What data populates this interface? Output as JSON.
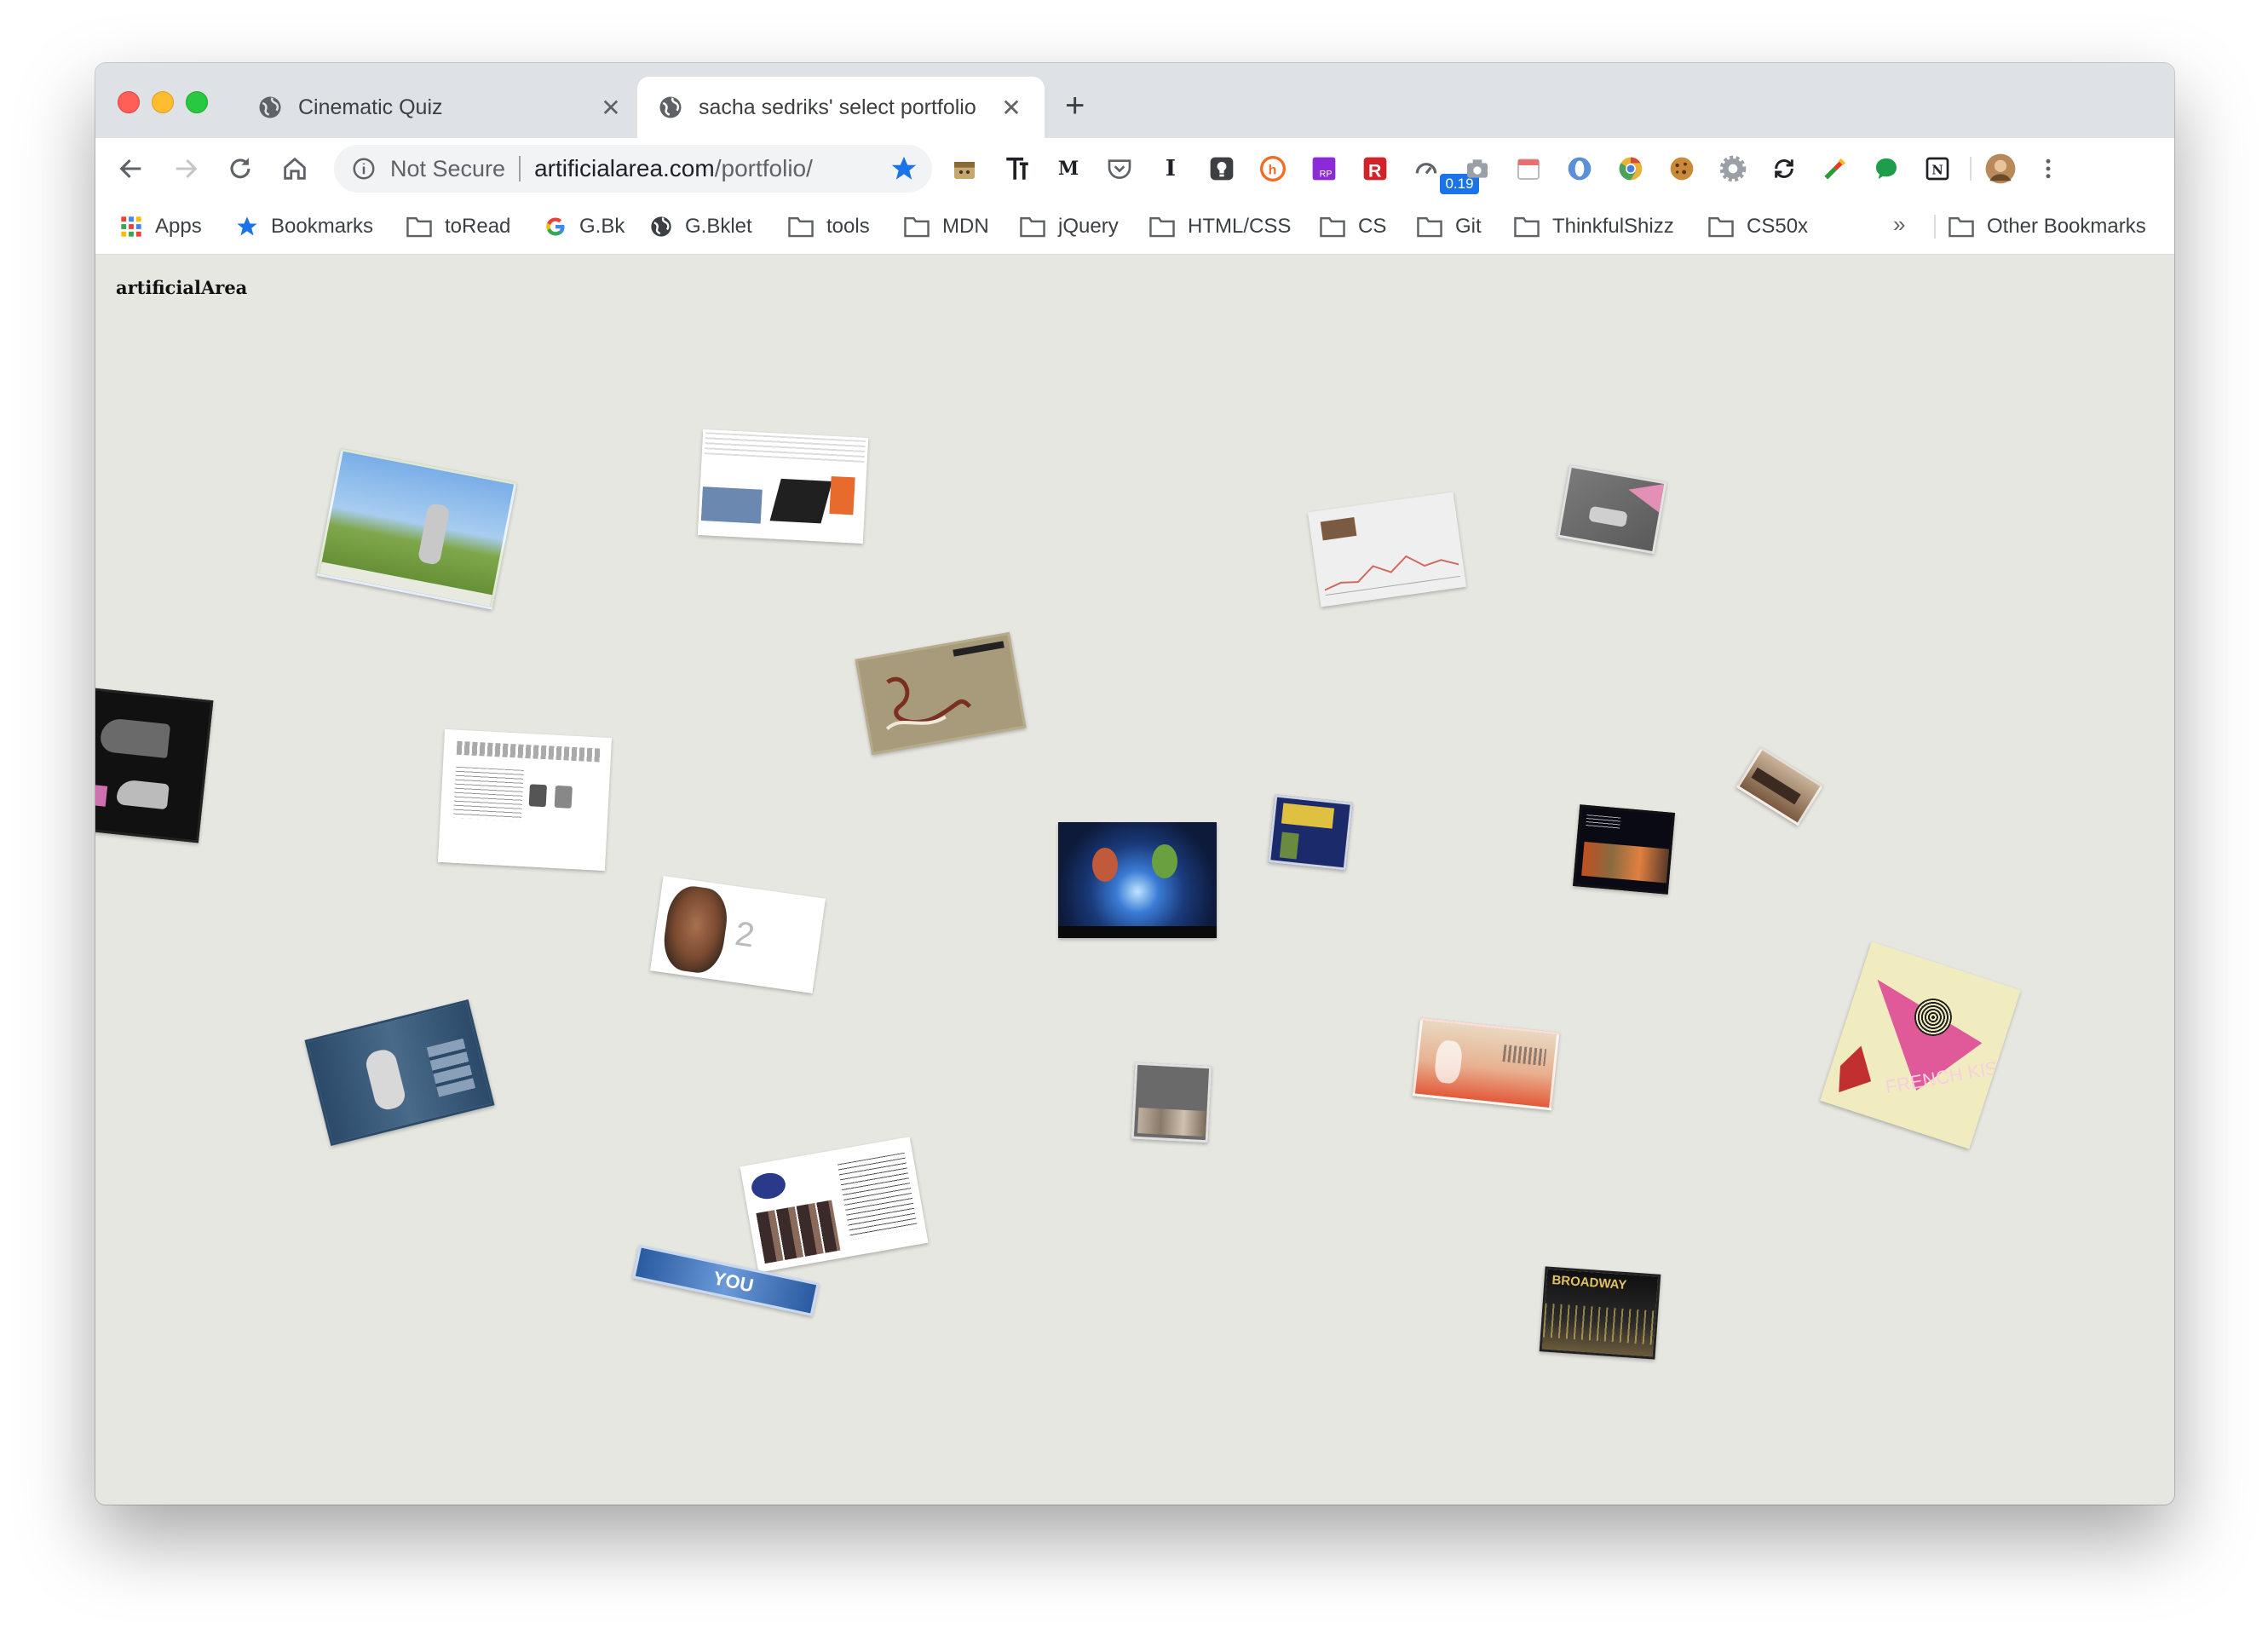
{
  "tabs": [
    {
      "title": "Cinematic Quiz",
      "close": "✕"
    },
    {
      "title": "sacha sedriks' select portfolio",
      "close": "✕"
    }
  ],
  "new_tab": "+",
  "omnibox": {
    "security": "Not Secure",
    "host": "artificialarea.com",
    "path": "/portfolio/"
  },
  "extension_badge": "0.19",
  "bookmarks": [
    {
      "label": "Apps",
      "icon": "apps-grid-icon"
    },
    {
      "label": "Bookmarks",
      "icon": "star-icon"
    },
    {
      "label": "toRead",
      "icon": "folder-icon"
    },
    {
      "label": "G.Bk",
      "icon": "google-icon"
    },
    {
      "label": "G.Bklet",
      "icon": "globe-icon"
    },
    {
      "label": "tools",
      "icon": "folder-icon"
    },
    {
      "label": "MDN",
      "icon": "folder-icon"
    },
    {
      "label": "jQuery",
      "icon": "folder-icon"
    },
    {
      "label": "HTML/CSS",
      "icon": "folder-icon"
    },
    {
      "label": "CS",
      "icon": "folder-icon"
    },
    {
      "label": "Git",
      "icon": "folder-icon"
    },
    {
      "label": "ThinkfulShizz",
      "icon": "folder-icon"
    },
    {
      "label": "CS50x",
      "icon": "folder-icon"
    }
  ],
  "bookmarks_overflow": "»",
  "other_bookmarks": "Other Bookmarks",
  "page": {
    "logo": "artificialArea",
    "background": "#e7e7e2"
  },
  "portfolio_thumbnails": [
    {
      "name": "golf-site",
      "colors": [
        "#6a9fd8",
        "#7fa64a"
      ],
      "text": ""
    },
    {
      "name": "office-illustration-site",
      "colors": [
        "#ffffff",
        "#e86a2c"
      ],
      "text": ""
    },
    {
      "name": "chart-site",
      "colors": [
        "#efefef",
        "#c96060"
      ],
      "text": ""
    },
    {
      "name": "pink-car-site",
      "colors": [
        "#666666",
        "#e38fb6"
      ],
      "text": ""
    },
    {
      "name": "sneaker-site",
      "colors": [
        "#111111",
        "#d070b0"
      ],
      "text": ""
    },
    {
      "name": "text-document-site",
      "colors": [
        "#ffffff",
        "#888888"
      ],
      "text": ""
    },
    {
      "name": "script-tan-site",
      "colors": [
        "#a89b7c",
        "#7a3020"
      ],
      "text": ""
    },
    {
      "name": "blue-party-site",
      "colors": [
        "#0d1a3a",
        "#3a7bd5"
      ],
      "text": ""
    },
    {
      "name": "game-banner-site",
      "colors": [
        "#1a2a6a",
        "#e0c040"
      ],
      "text": ""
    },
    {
      "name": "dark-movie-site",
      "colors": [
        "#0a0a14",
        "#c05020"
      ],
      "text": ""
    },
    {
      "name": "sepia-landscape-site",
      "colors": [
        "#b29a80",
        "#3a2a20"
      ],
      "text": ""
    },
    {
      "name": "face-portrait-site",
      "colors": [
        "#ffffff",
        "#7a4a30"
      ],
      "text": ""
    },
    {
      "name": "sports-blue-site",
      "colors": [
        "#2b4a6a",
        "#6a8aaa"
      ],
      "text": ""
    },
    {
      "name": "grey-band-site",
      "colors": [
        "#6a6a6a",
        "#c0b0a0"
      ],
      "text": ""
    },
    {
      "name": "illustrated-orange-site",
      "colors": [
        "#e8d8c0",
        "#e25a3a"
      ],
      "text": ""
    },
    {
      "name": "french-kiss-poster",
      "colors": [
        "#f0ecc0",
        "#e05a9a"
      ],
      "text": "FRENCH KISS"
    },
    {
      "name": "magazine-collage-site",
      "colors": [
        "#ffffff",
        "#2a3a8a"
      ],
      "text": ""
    },
    {
      "name": "hp-banner",
      "colors": [
        "#5a8ad0",
        "#ffffff"
      ],
      "text": "YOU"
    },
    {
      "name": "broadway-site",
      "colors": [
        "#101010",
        "#e0c060"
      ],
      "text": "BROADWAY"
    }
  ]
}
